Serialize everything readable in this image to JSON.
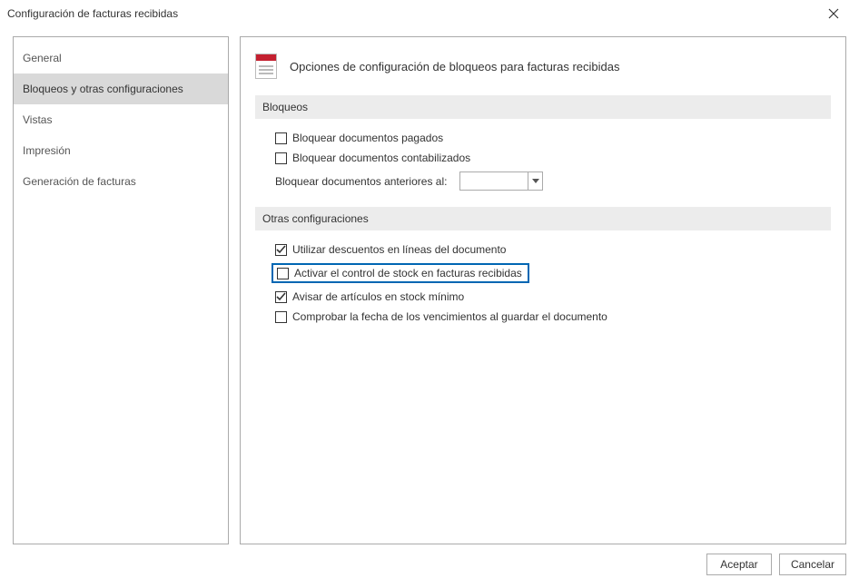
{
  "window": {
    "title": "Configuración de facturas recibidas"
  },
  "sidebar": {
    "items": [
      {
        "label": "General"
      },
      {
        "label": "Bloqueos y otras configuraciones"
      },
      {
        "label": "Vistas"
      },
      {
        "label": "Impresión"
      },
      {
        "label": "Generación de facturas"
      }
    ],
    "selected_index": 1
  },
  "content": {
    "heading": "Opciones de configuración de bloqueos para facturas recibidas",
    "sections": {
      "bloqueos": {
        "title": "Bloqueos",
        "block_paid": {
          "label": "Bloquear documentos pagados",
          "checked": false
        },
        "block_posted": {
          "label": "Bloquear documentos contabilizados",
          "checked": false
        },
        "block_before": {
          "label": "Bloquear documentos anteriores al:",
          "value": ""
        }
      },
      "otras": {
        "title": "Otras configuraciones",
        "use_discounts": {
          "label": "Utilizar descuentos en líneas del documento",
          "checked": true
        },
        "stock_control": {
          "label": "Activar el control de stock en facturas recibidas",
          "checked": false
        },
        "min_stock_warn": {
          "label": "Avisar de artículos en stock mínimo",
          "checked": true
        },
        "check_due_date": {
          "label": "Comprobar la fecha de los vencimientos al guardar el documento",
          "checked": false
        }
      }
    }
  },
  "buttons": {
    "accept": "Aceptar",
    "cancel": "Cancelar"
  }
}
